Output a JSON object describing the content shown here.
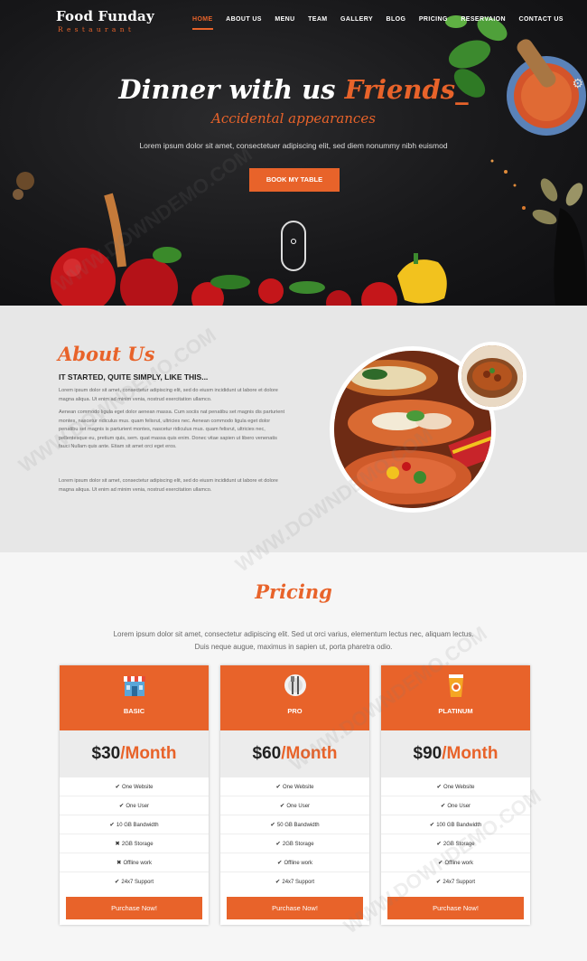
{
  "brand": {
    "name": "Food Funday",
    "tagline": "Restaurant"
  },
  "nav": [
    "HOME",
    "ABOUT US",
    "MENU",
    "TEAM",
    "GALLERY",
    "BLOG",
    "PRICING",
    "RESERVAION",
    "CONTACT US"
  ],
  "hero": {
    "title_main": "Dinner with us ",
    "title_accent": "Friends_",
    "subtitle": "Accidental appearances",
    "text": "Lorem ipsum dolor sit amet, consectetuer adipiscing elit, sed diem nonummy nibh euismod",
    "button": "BOOK MY TABLE"
  },
  "about": {
    "title": "About Us",
    "heading": "IT STARTED, QUITE SIMPLY, LIKE THIS...",
    "p1": "Lorem ipsum dolor sit amet, consectetur adipiscing elit, sed do eiusm incididunt ut labore et dolore magna aliqua. Ut enim ad minim venia, nostrud exercitation ullamco.",
    "p2": "Aenean commodo ligula eget dolor aenean massa. Cum sociis nat penatibu set magnis dis parturient montes, nascetur ridiculus mus. quam felisrut, ultricies nec. Aenean commodo ligula eget dolor penatibu set magnis is parturient montes, nascetur ridiculus mus. quam felisrut, ultricies nec, pellentesque eu, pretium quis, sem. quat massa quis enim. Donec vitae sapien ut libero venenatis fauci Nullam quis ante. Etiam sit amet orci eget eros.",
    "p3": "Lorem ipsum dolor sit amet, consectetur adipiscing elit, sed do eiusm incididunt ut labore et dolore magna aliqua. Ut enim ad minim venia, nostrud exercitation ullamco."
  },
  "pricing": {
    "title": "Pricing",
    "description": "Lorem ipsum dolor sit amet, consectetur adipiscing elit. Sed ut orci varius, elementum lectus nec, aliquam lectus. Duis neque augue, maximus in sapien ut, porta pharetra odio.",
    "plans": [
      {
        "name": "BASIC",
        "price": "$30",
        "per": "/Month",
        "icon": "shop-icon",
        "features": [
          [
            "check",
            "One Website"
          ],
          [
            "check",
            "One User"
          ],
          [
            "check",
            "10 GB Bandwidth"
          ],
          [
            "cross",
            "2GB Storage"
          ],
          [
            "cross",
            "Offline work"
          ],
          [
            "check",
            "24x7 Support"
          ]
        ],
        "button": "Purchase Now!"
      },
      {
        "name": "PRO",
        "price": "$60",
        "per": "/Month",
        "icon": "cutlery-icon",
        "features": [
          [
            "check",
            "One Website"
          ],
          [
            "check",
            "One User"
          ],
          [
            "check",
            "50 GB Bandwidth"
          ],
          [
            "check",
            "2GB Storage"
          ],
          [
            "check",
            "Offline work"
          ],
          [
            "check",
            "24x7 Support"
          ]
        ],
        "button": "Purchase Now!"
      },
      {
        "name": "PLATINUM",
        "price": "$90",
        "per": "/Month",
        "icon": "cup-icon",
        "features": [
          [
            "check",
            "One Website"
          ],
          [
            "check",
            "One User"
          ],
          [
            "check",
            "100 GB Bandwidth"
          ],
          [
            "check",
            "2GB Storage"
          ],
          [
            "check",
            "Offline work"
          ],
          [
            "check",
            "24x7 Support"
          ]
        ],
        "button": "Purchase Now!"
      }
    ]
  },
  "watermark": "WWW.DOWNDEMO.COM",
  "colors": {
    "accent": "#e8632a",
    "dark": "#18181a",
    "grey": "#e7e7e7"
  }
}
